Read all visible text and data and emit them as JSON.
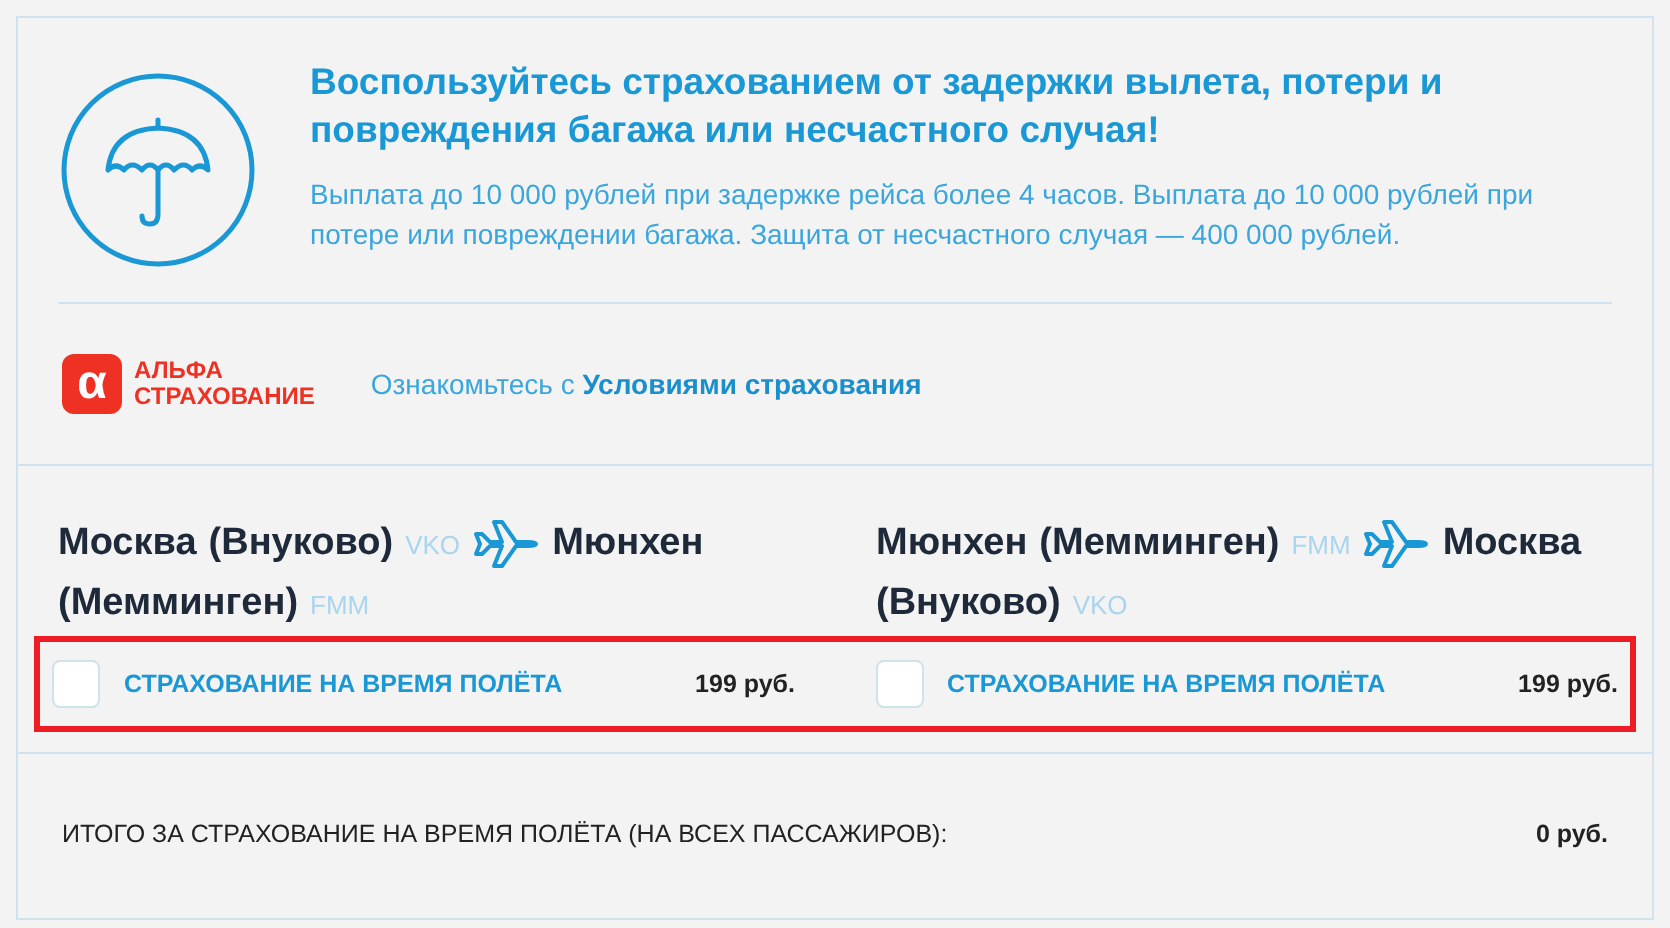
{
  "promo": {
    "title": "Воспользуйтесь страхованием от задержки вылета, потери и повреждения багажа или несчастного случая!",
    "text": "Выплата до 10 000 рублей при задержке рейса более 4 часов. Выплата до 10 000 рублей при потере или повреждении багажа. Защита от несчастного случая — 400 000 рублей."
  },
  "insurer": {
    "logo_mark": "α",
    "logo_lines": [
      "АЛЬФА",
      "СТРАХОВАНИЕ"
    ],
    "terms_prefix": "Ознакомьтесь с",
    "terms_link": "Условиями страхования"
  },
  "flights": [
    {
      "from": [
        "Москва",
        "(Внуково)"
      ],
      "from_code": "VKO",
      "to": [
        "Мюнхен",
        "(Мемминген)"
      ],
      "to_code": "FMM",
      "option": "СТРАХОВАНИЕ НА ВРЕМЯ ПОЛЁТА",
      "price": "199 руб.",
      "checked": false
    },
    {
      "from": [
        "Мюнхен",
        "(Мемминген)"
      ],
      "from_code": "FMM",
      "to": [
        "Москва",
        "(Внуково)"
      ],
      "to_code": "VKO",
      "option": "СТРАХОВАНИЕ НА ВРЕМЯ ПОЛЁТА",
      "price": "199 руб.",
      "checked": false
    }
  ],
  "total": {
    "label": "ИТОГО ЗА СТРАХОВАНИЕ НА ВРЕМЯ ПОЛЁТА (НА ВСЕХ ПАССАЖИРОВ):",
    "value": "0 руб."
  }
}
